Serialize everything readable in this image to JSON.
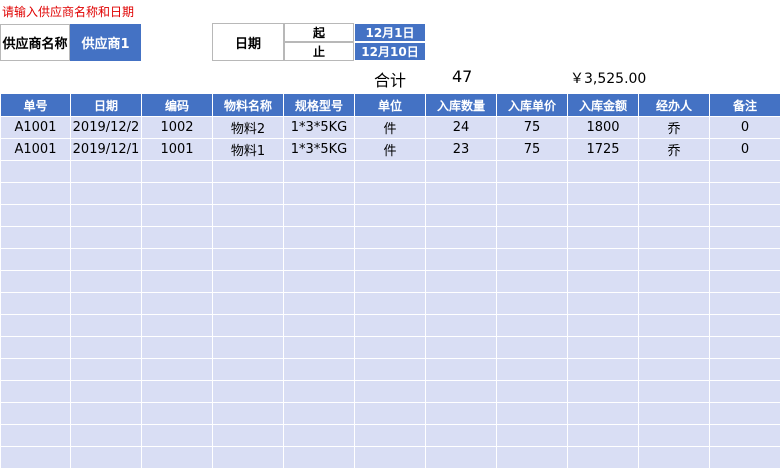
{
  "hint": "请输入供应商名称和日期",
  "supplier": {
    "label": "供应商名称",
    "value": "供应商1"
  },
  "date": {
    "label": "日期",
    "from_label": "起",
    "from_value": "12月1日",
    "to_label": "止",
    "to_value": "12月10日"
  },
  "summary": {
    "label": "合计",
    "quantity": "47",
    "amount": "￥3,525.00"
  },
  "table": {
    "columns": [
      "单号",
      "日期",
      "编码",
      "物料名称",
      "规格型号",
      "单位",
      "入库数量",
      "入库单价",
      "入库金额",
      "经办人",
      "备注"
    ],
    "rows": [
      [
        "A1001",
        "2019/12/2",
        "1002",
        "物料2",
        "1*3*5KG",
        "件",
        "24",
        "75",
        "1800",
        "乔",
        "0"
      ],
      [
        "A1001",
        "2019/12/1",
        "1001",
        "物料1",
        "1*3*5KG",
        "件",
        "23",
        "75",
        "1725",
        "乔",
        "0"
      ]
    ],
    "empty_rows": 14
  },
  "colors": {
    "header": "#4472c4",
    "row": "#d9def4",
    "hint": "#e00000"
  }
}
